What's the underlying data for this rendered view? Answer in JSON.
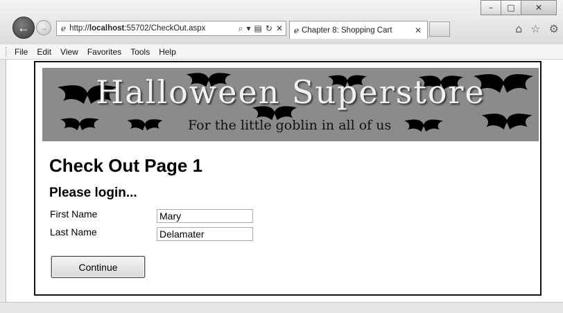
{
  "browser": {
    "address_url_prefix": "http://",
    "address_url_host": "localhost",
    "address_url_rest": ":55702/CheckOut.aspx",
    "tab_title": "Chapter 8: Shopping Cart",
    "menu": [
      "File",
      "Edit",
      "View",
      "Favorites",
      "Tools",
      "Help"
    ],
    "icons": {
      "back": "back-arrow-icon",
      "forward": "forward-arrow-icon",
      "home": "home-icon",
      "favorites": "star-icon",
      "tools": "gear-icon"
    }
  },
  "banner": {
    "title": "Halloween Superstore",
    "subtitle": "For the little goblin in all of us"
  },
  "page": {
    "title": "Check Out Page 1",
    "subtitle": "Please login...",
    "first_name_label": "First Name",
    "first_name_value": "Mary",
    "last_name_label": "Last Name",
    "last_name_value": "Delamater",
    "continue_label": "Continue"
  },
  "colors": {
    "banner_bg": "#8b8b8b",
    "frame_border": "#111111"
  }
}
